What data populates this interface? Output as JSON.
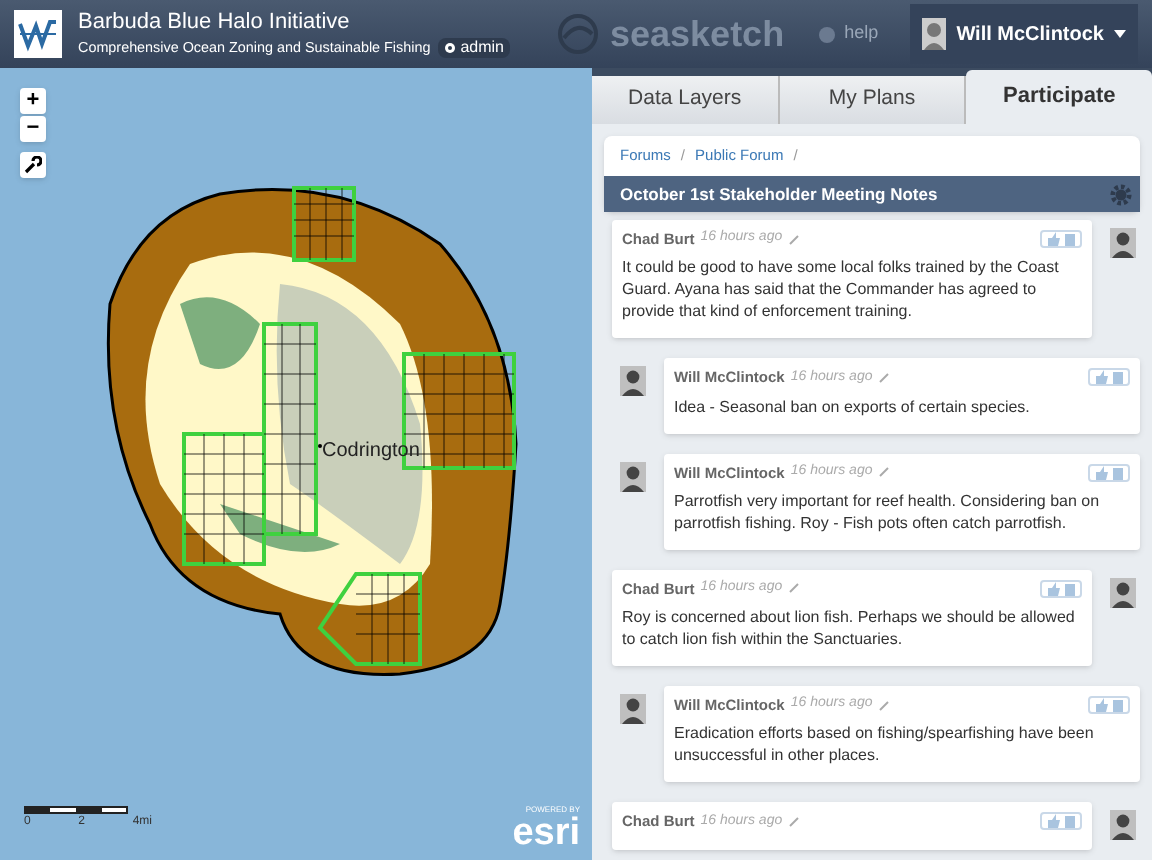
{
  "header": {
    "title": "Barbuda Blue Halo Initiative",
    "subtitle": "Comprehensive Ocean Zoning and Sustainable Fishing",
    "badge": "admin",
    "brand": "seasketch",
    "help": "help",
    "user": "Will McClintock"
  },
  "map": {
    "place_label": "Codrington",
    "scale_labels": [
      "0",
      "2",
      "4mi"
    ],
    "attribution_top": "POWERED BY",
    "attribution": "esri",
    "controls": [
      {
        "kind": "zoom-in",
        "label": "+"
      },
      {
        "kind": "zoom-out",
        "label": "−"
      },
      {
        "kind": "tools"
      }
    ]
  },
  "tabs": [
    {
      "label": "Data Layers",
      "selected": false
    },
    {
      "label": "My Plans",
      "selected": false
    },
    {
      "label": "Participate",
      "selected": true
    }
  ],
  "breadcrumb": {
    "links": [
      "Forums",
      "Public Forum"
    ],
    "separator": "/"
  },
  "topic_title": "October 1st Stakeholder Meeting Notes",
  "comments": [
    {
      "kind": "post",
      "author": "Chad Burt",
      "time": "16 hours ago",
      "text": "It could be good to have some local folks trained by the Coast Guard. Ayana has said that the Commander has agreed to provide that kind of enforcement training."
    },
    {
      "kind": "reply",
      "author": "Will McClintock",
      "time": "16 hours ago",
      "text": "Idea - Seasonal ban on exports of certain species."
    },
    {
      "kind": "reply",
      "author": "Will McClintock",
      "time": "16 hours ago",
      "text": "Parrotfish very important for reef health. Considering ban on parrotfish fishing. Roy - Fish pots often catch parrotfish."
    },
    {
      "kind": "post",
      "author": "Chad Burt",
      "time": "16 hours ago",
      "text": "Roy is concerned about lion fish. Perhaps we should be allowed to catch lion fish within the Sanctuaries."
    },
    {
      "kind": "reply",
      "author": "Will McClintock",
      "time": "16 hours ago",
      "text": "Eradication efforts based on fishing/spearfishing have been unsuccessful in other places."
    },
    {
      "kind": "post",
      "author": "Chad Burt",
      "time": "16 hours ago"
    }
  ]
}
